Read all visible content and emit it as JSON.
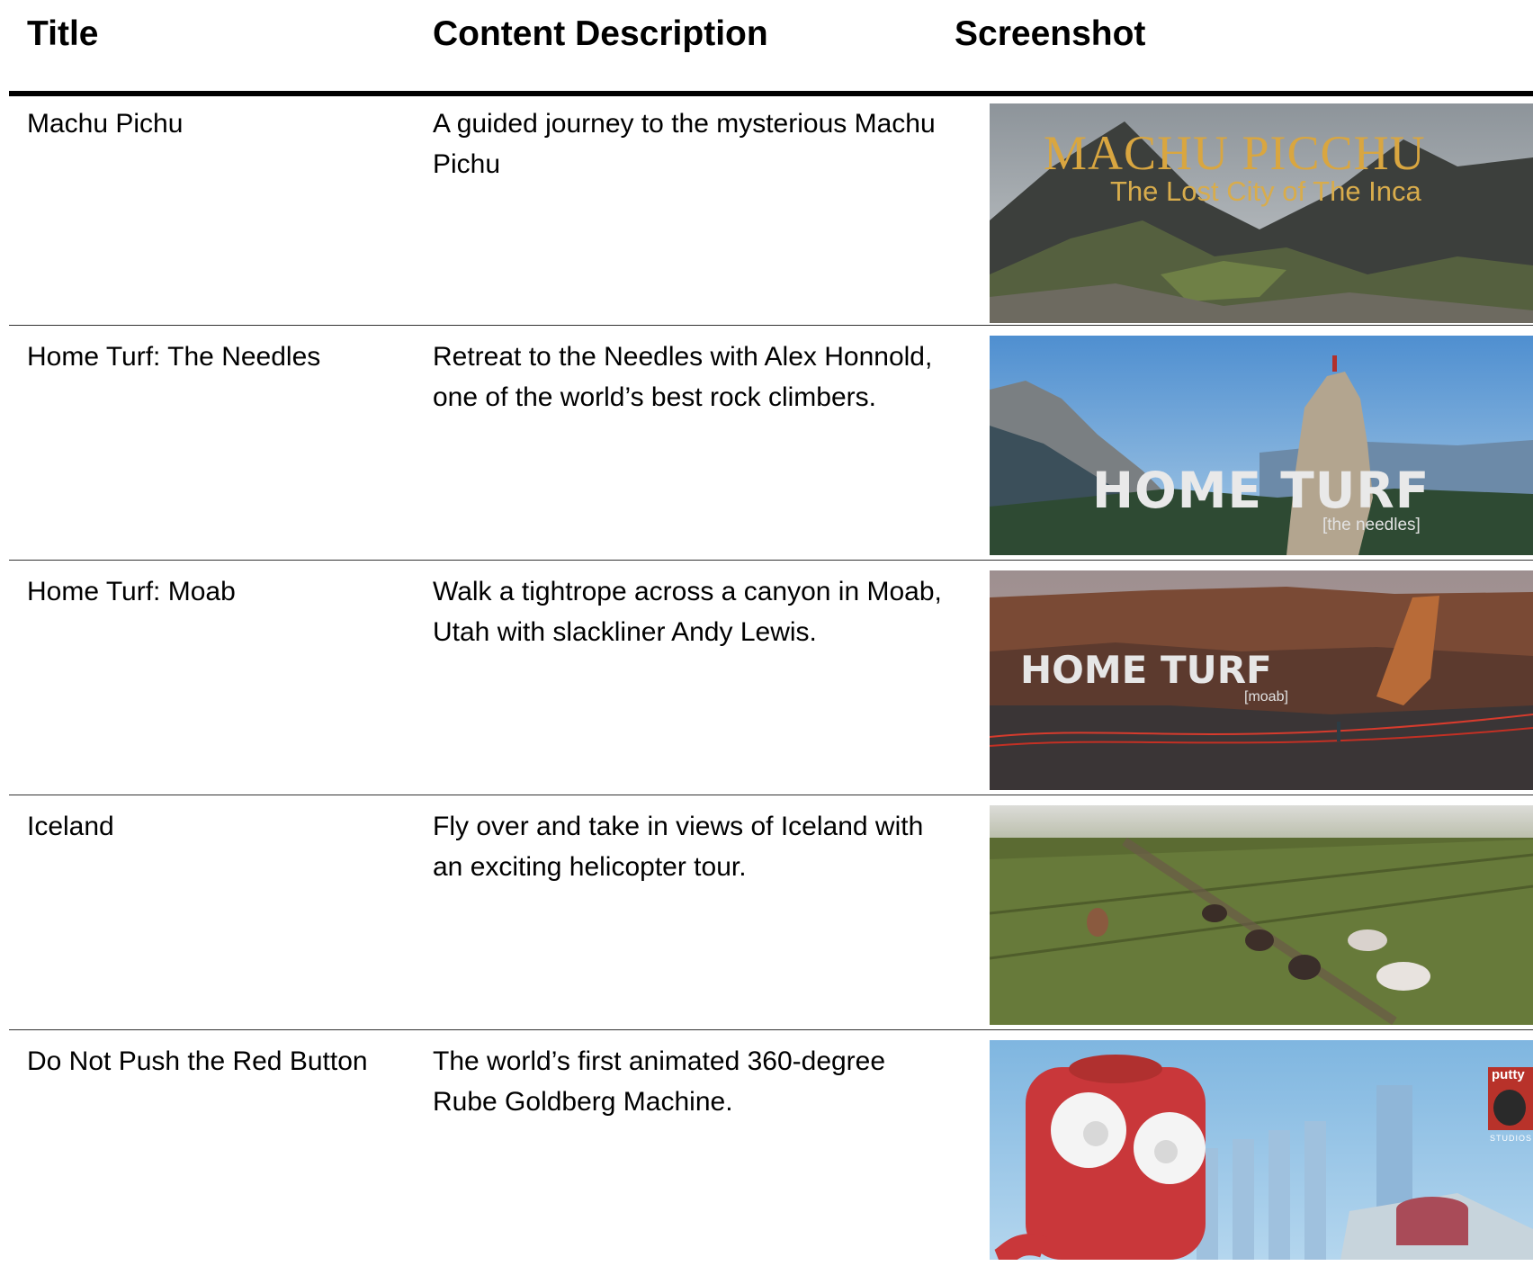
{
  "headers": {
    "title": "Title",
    "description": "Content Description",
    "screenshot": "Screenshot"
  },
  "rows": [
    {
      "title": "Machu Pichu",
      "description": "A guided journey to the mysterious Machu Pichu",
      "thumb_title": "MACHU PICCHU",
      "thumb_subtitle": "The Lost City of The Inca"
    },
    {
      "title": "Home Turf: The Needles",
      "description": "Retreat to the Needles with Alex Honnold, one of the world’s best rock climbers.",
      "thumb_title": "HOME TURF",
      "thumb_subtitle": "[the needles]"
    },
    {
      "title": "Home Turf: Moab",
      "description": "Walk a tightrope across a canyon in Moab, Utah with slackliner Andy Lewis.",
      "thumb_title": "HOME TURF",
      "thumb_subtitle": "[moab]"
    },
    {
      "title": "Iceland",
      "description": "Fly over and take in views of Iceland with an exciting helicopter tour."
    },
    {
      "title": "Do Not Push the Red Button",
      "description": "The world’s first animated 360-degree Rube Goldberg Machine.",
      "thumb_logo_text": "putty",
      "thumb_logo_sub": "STUDIOS"
    }
  ]
}
